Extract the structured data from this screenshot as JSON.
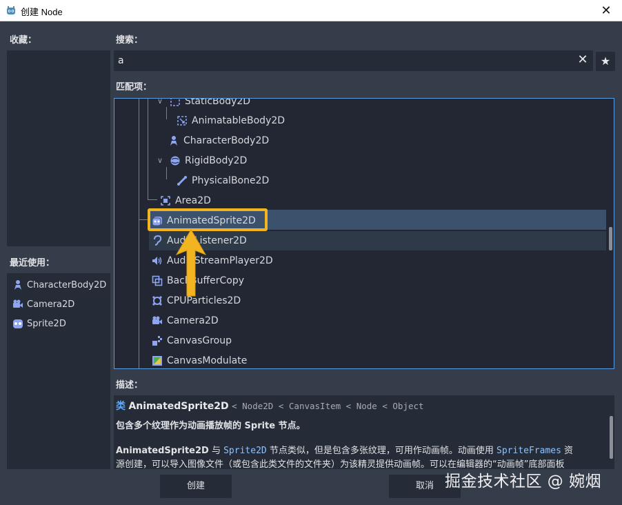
{
  "window": {
    "title": "创建 Node",
    "close": "✕"
  },
  "favorites": {
    "label": "收藏："
  },
  "recent": {
    "label": "最近使用：",
    "items": [
      {
        "label": "CharacterBody2D",
        "icon": "character-body-icon"
      },
      {
        "label": "Camera2D",
        "icon": "camera-icon"
      },
      {
        "label": "Sprite2D",
        "icon": "sprite-icon"
      }
    ]
  },
  "search": {
    "label": "搜索：",
    "value": "a",
    "clear": "✕",
    "favorite": "★"
  },
  "matches": {
    "label": "匹配项：",
    "rows": [
      {
        "label": "StaticBody2D",
        "icon": "static-body-icon"
      },
      {
        "label": "AnimatableBody2D",
        "icon": "animatable-body-icon"
      },
      {
        "label": "CharacterBody2D",
        "icon": "character-body-icon"
      },
      {
        "label": "RigidBody2D",
        "icon": "rigid-body-icon"
      },
      {
        "label": "PhysicalBone2D",
        "icon": "bone-icon"
      },
      {
        "label": "Area2D",
        "icon": "area-icon"
      },
      {
        "label": "AnimatedSprite2D",
        "icon": "animated-sprite-icon",
        "selected": true
      },
      {
        "label": "AudioListener2D",
        "icon": "ear-icon"
      },
      {
        "label": "AudioStreamPlayer2D",
        "icon": "speaker-icon"
      },
      {
        "label": "BackBufferCopy",
        "icon": "backbuffer-icon"
      },
      {
        "label": "CPUParticles2D",
        "icon": "particles-icon"
      },
      {
        "label": "Camera2D",
        "icon": "camera-icon"
      },
      {
        "label": "CanvasGroup",
        "icon": "canvas-group-icon"
      },
      {
        "label": "CanvasModulate",
        "icon": "canvas-modulate-icon"
      }
    ]
  },
  "description": {
    "label": "描述：",
    "keyword": "类",
    "class_name": "AnimatedSprite2D",
    "inheritance": "< Node2D < CanvasItem < Node < Object",
    "summary": "包含多个纹理作为动画播放帧的 Sprite 节点。",
    "body_1": "AnimatedSprite2D",
    "body_2": " 与 ",
    "body_3": "Sprite2D",
    "body_4": " 节点类似，但是包含多张纹理，可用作动画帧。动画使用 ",
    "body_5": "SpriteFrames",
    "body_6": " 资",
    "body_line2": "源创建，可以导入图像文件（或包含此类文件的文件夹）为该精灵提供动画帧。可以在编辑器的“动画帧”底部面板"
  },
  "buttons": {
    "create": "创建",
    "cancel": "取消"
  },
  "watermark": "掘金技术社区 @ 婉烟",
  "colors": {
    "accent": "#5a9de0",
    "highlight": "#f2b521",
    "selection": "#3c516b",
    "icon": "#8da5f3"
  }
}
